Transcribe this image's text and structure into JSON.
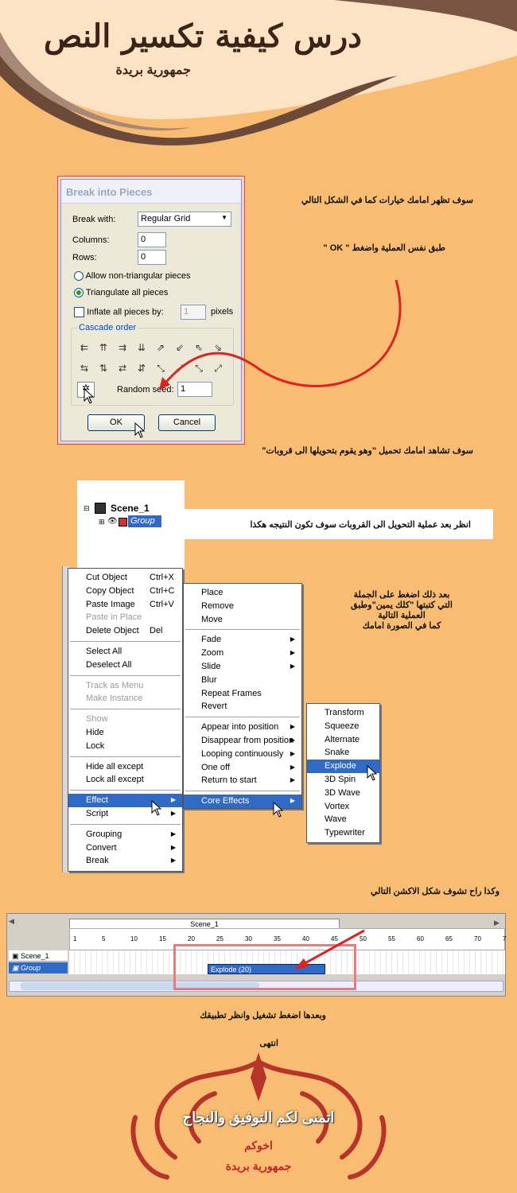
{
  "header": {
    "title": "درس كيفية تكسير النص",
    "subtitle": "جمهورية بريدة"
  },
  "instructions": {
    "step1": "سوف تظهر امامك خيارات كما في الشكل التالي",
    "step2": "طبق نفس العملية واضغط \" OK \"",
    "step3": "سوف تشاهد امامك تحميل \"وهو يقوم بتحويلها الى قروبات\"",
    "step4": "انظر بعد عملية التحويل الى القروبات سوف تكون النتيجه هكذا",
    "step5": [
      "بعد ذلك اضغط على الجملة",
      "التي كتبتها \"كلك يمين\"وطبق",
      "العملية التالية",
      "كما في الصورة امامك"
    ],
    "step6": "وكذا راح تشوف شكل الاكشن التالي",
    "step7": "وبعدها اضغط تشغيل وانظر تطبيقك",
    "end": "انتهى"
  },
  "dialog": {
    "title": "Break into Pieces",
    "break_with_label": "Break with:",
    "break_with_value": "Regular Grid",
    "columns_label": "Columns:",
    "columns_value": "0",
    "rows_label": "Rows:",
    "rows_value": "0",
    "radio1": "Allow non-triangular pieces",
    "radio2": "Triangulate all pieces",
    "inflate_label": "Inflate all pieces by:",
    "inflate_value": "1",
    "inflate_unit": "pixels",
    "cascade_label": "Cascade order",
    "random_seed_label": "Random seed:",
    "random_seed_value": "1",
    "ok": "OK",
    "cancel": "Cancel"
  },
  "scene_tree": {
    "scene": "Scene_1",
    "group": "Group"
  },
  "context_menu": [
    {
      "label": "Cut Object",
      "shortcut": "Ctrl+X"
    },
    {
      "label": "Copy Object",
      "shortcut": "Ctrl+C"
    },
    {
      "label": "Paste Image",
      "shortcut": "Ctrl+V"
    },
    {
      "label": "Paste in Place",
      "disabled": true
    },
    {
      "label": "Delete Object",
      "shortcut": "Del"
    },
    {
      "sep": true
    },
    {
      "label": "Select All"
    },
    {
      "label": "Deselect All"
    },
    {
      "sep": true
    },
    {
      "label": "Track as Menu",
      "disabled": true
    },
    {
      "label": "Make Instance",
      "disabled": true
    },
    {
      "sep": true
    },
    {
      "label": "Show",
      "disabled": true
    },
    {
      "label": "Hide"
    },
    {
      "label": "Lock"
    },
    {
      "sep": true
    },
    {
      "label": "Hide all except"
    },
    {
      "label": "Lock all except"
    },
    {
      "sep": true
    },
    {
      "label": "Effect",
      "submenu": true,
      "selected": true
    },
    {
      "label": "Script",
      "submenu": true
    },
    {
      "sep": true
    },
    {
      "label": "Grouping",
      "submenu": true
    },
    {
      "label": "Convert",
      "submenu": true
    },
    {
      "label": "Break",
      "submenu": true
    }
  ],
  "effect_menu": [
    {
      "label": "Place"
    },
    {
      "label": "Remove"
    },
    {
      "label": "Move"
    },
    {
      "sep": true
    },
    {
      "label": "Fade",
      "submenu": true
    },
    {
      "label": "Zoom",
      "submenu": true
    },
    {
      "label": "Slide",
      "submenu": true
    },
    {
      "label": "Blur"
    },
    {
      "label": "Repeat Frames"
    },
    {
      "label": "Revert"
    },
    {
      "sep": true
    },
    {
      "label": "Appear into position",
      "submenu": true
    },
    {
      "label": "Disappear from position",
      "submenu": true
    },
    {
      "label": "Looping continuously",
      "submenu": true
    },
    {
      "label": "One off",
      "submenu": true
    },
    {
      "label": "Return to start",
      "submenu": true
    },
    {
      "sep": true
    },
    {
      "label": "Core Effects",
      "submenu": true,
      "selected": true
    }
  ],
  "core_effects_menu": [
    {
      "label": "Transform"
    },
    {
      "label": "Squeeze"
    },
    {
      "label": "Alternate"
    },
    {
      "label": "Snake"
    },
    {
      "label": "Explode",
      "selected": true
    },
    {
      "label": "3D Spin"
    },
    {
      "label": "3D Wave"
    },
    {
      "label": "Vortex"
    },
    {
      "label": "Wave"
    },
    {
      "label": "Typewriter"
    }
  ],
  "timeline": {
    "scene_header": "Scene_1",
    "row1": "Scene_1",
    "row2": "Group",
    "ticks": [
      "1",
      "5",
      "10",
      "15",
      "20",
      "25",
      "30",
      "35",
      "40",
      "45",
      "50",
      "55",
      "60",
      "65",
      "70",
      "7"
    ],
    "effect_bar": "Explode (20)"
  },
  "footer": {
    "wish": "اتمنى لكم التوفيق والنجاح",
    "brother": "اخوكم",
    "sign": "جمهورية بريدة"
  },
  "colors": {
    "background": "#f8bd72",
    "menu_selected": "#316ac5",
    "accent_red": "#d22"
  }
}
